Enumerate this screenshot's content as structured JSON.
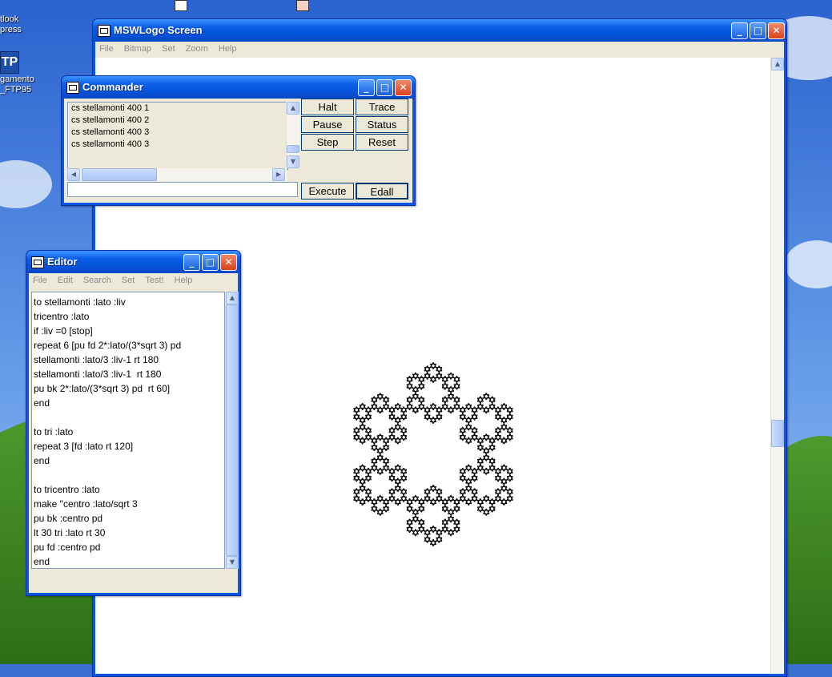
{
  "desktop": {
    "icons": [
      {
        "name": "outlook-express-icon",
        "label_line1": "tlook",
        "label_line2": "press"
      },
      {
        "name": "ftp95-icon",
        "label_line1": "gamento",
        "label_line2": "_FTP95",
        "badge": "TP"
      }
    ]
  },
  "screen": {
    "title": "MSWLogo Screen",
    "menu": [
      "File",
      "Bitmap",
      "Set",
      "Zoom",
      "Help"
    ]
  },
  "commander": {
    "title": "Commander",
    "history": [
      "cs stellamonti 400 1",
      "cs stellamonti 400 2",
      "cs stellamonti 400 3",
      "cs stellamonti 400 3"
    ],
    "input_value": "",
    "buttons": {
      "halt": "Halt",
      "trace": "Trace",
      "pause": "Pause",
      "status": "Status",
      "step": "Step",
      "reset": "Reset",
      "execute": "Execute",
      "edall": "Edall"
    }
  },
  "editor": {
    "title": "Editor",
    "menu": [
      "File",
      "Edit",
      "Search",
      "Set",
      "Test!",
      "Help"
    ],
    "lines": [
      "to stellamonti :lato :liv",
      "tricentro :lato",
      "if :liv =0 [stop]",
      "repeat 6 [pu fd 2*:lato/(3*sqrt 3) pd",
      "stellamonti :lato/3 :liv-1 rt 180",
      "stellamonti :lato/3 :liv-1  rt 180",
      "pu bk 2*:lato/(3*sqrt 3) pd  rt 60]",
      "end",
      "",
      "to tri :lato",
      "repeat 3 [fd :lato rt 120]",
      "end",
      "",
      "to tricentro :lato",
      "make \"centro :lato/sqrt 3",
      "pu bk :centro pd",
      "lt 30 tri :lato rt 30",
      "pu fd :centro pd",
      "end"
    ]
  },
  "colors": {
    "titlebar": "#0a5fe8",
    "close": "#d8421c",
    "window_face": "#ece9d8"
  }
}
